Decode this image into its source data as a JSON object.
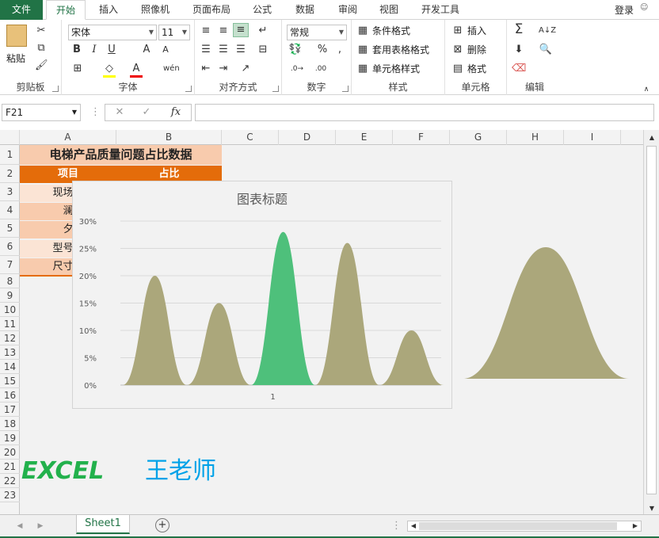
{
  "tabs": [
    "文件",
    "开始",
    "插入",
    "照像机",
    "页面布局",
    "公式",
    "数据",
    "审阅",
    "视图",
    "开发工具"
  ],
  "login": "登录",
  "ribbon": {
    "clipboard": {
      "label": "剪贴板",
      "paste": "粘贴"
    },
    "font": {
      "label": "字体",
      "name": "宋体",
      "size": "11",
      "bold": "B",
      "italic": "I",
      "underline": "U"
    },
    "align": {
      "label": "对齐方式"
    },
    "number": {
      "label": "数字",
      "format": "常规"
    },
    "styles": {
      "label": "样式",
      "cond": "条件格式",
      "table": "套用表格格式",
      "cell": "单元格样式"
    },
    "cells": {
      "label": "单元格",
      "insert": "插入",
      "delete": "删除",
      "format": "格式"
    },
    "edit": {
      "label": "编辑"
    }
  },
  "namebox": "F21",
  "columns": [
    "A",
    "B",
    "C",
    "D",
    "E",
    "F",
    "G",
    "H",
    "I"
  ],
  "rows": [
    "1",
    "2",
    "3",
    "4",
    "5",
    "6",
    "7",
    "8",
    "9",
    "10",
    "11",
    "12",
    "13",
    "14",
    "15",
    "16",
    "17",
    "18",
    "19",
    "20",
    "21",
    "22",
    "23"
  ],
  "table": {
    "title": "电梯产品质量问题占比数据",
    "header": [
      "项目",
      "占比"
    ],
    "rows": [
      "现场扌",
      "澜",
      "夕",
      "型号钅",
      "尺寸钅"
    ]
  },
  "colors": {
    "accent": "#217346",
    "orange": "#e46c0a",
    "peach": "#f8cbad",
    "olive": "#aba77b",
    "green": "#4ec07b",
    "wm_green": "#22b14c",
    "wm_blue": "#00a2e8"
  },
  "chart_data": {
    "type": "area",
    "title": "图表标题",
    "categories": [
      "1"
    ],
    "yticks": [
      "0%",
      "5%",
      "10%",
      "15%",
      "20%",
      "25%",
      "30%"
    ],
    "ylim": [
      0,
      0.3
    ],
    "series": [
      {
        "values": [
          0.2,
          0.15,
          0.28,
          0.26,
          0.1
        ]
      }
    ],
    "highlight_index": 2,
    "grid": true
  },
  "chart2": {
    "type": "area",
    "value": 0.25
  },
  "watermark": {
    "left": "EXCEL",
    "right": "王老师"
  },
  "sheet_tab": "Sheet1"
}
